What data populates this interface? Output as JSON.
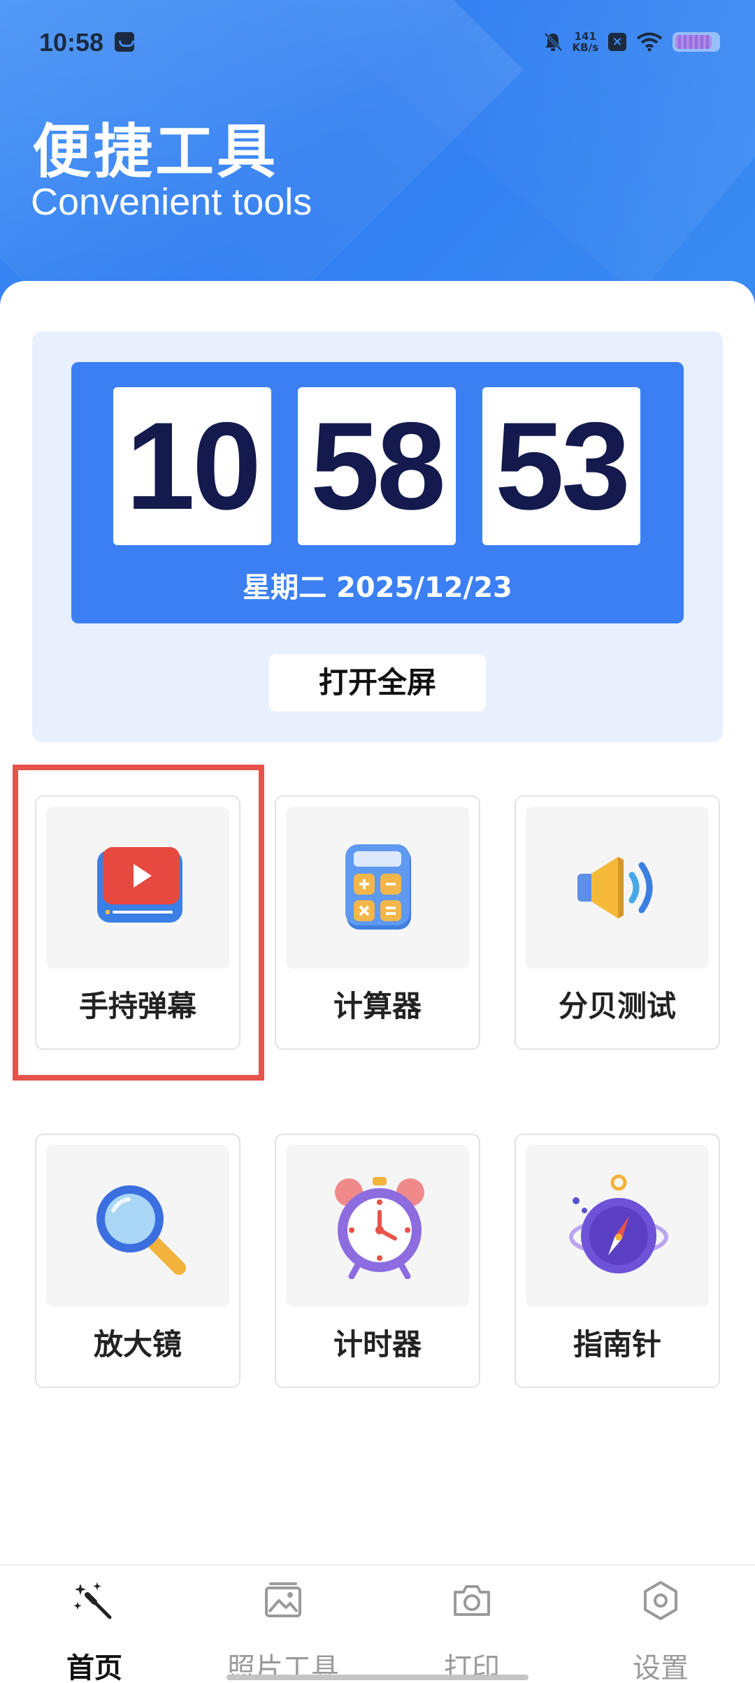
{
  "status_bar": {
    "time": "10:58",
    "net_speed_value": "141",
    "net_speed_unit": "KB/s",
    "icons": [
      "calendar-icon",
      "mute-bell-icon",
      "net-speed-icon",
      "x-app-icon",
      "wifi-icon",
      "battery-icon"
    ]
  },
  "header": {
    "title": "便捷工具",
    "subtitle": "Convenient tools"
  },
  "clock": {
    "hours": "10",
    "minutes": "58",
    "seconds": "53",
    "date": "星期二 2025/12/23",
    "fullscreen_label": "打开全屏"
  },
  "tools": [
    {
      "label": "手持弹幕",
      "icon": "video-banner-icon"
    },
    {
      "label": "计算器",
      "icon": "calculator-icon"
    },
    {
      "label": "分贝测试",
      "icon": "speaker-icon"
    },
    {
      "label": "放大镜",
      "icon": "magnifier-icon"
    },
    {
      "label": "计时器",
      "icon": "alarm-clock-icon"
    },
    {
      "label": "指南针",
      "icon": "compass-icon"
    }
  ],
  "nav": [
    {
      "label": "首页",
      "icon": "magic-wand-icon",
      "active": true
    },
    {
      "label": "照片工具",
      "icon": "photo-icon",
      "active": false
    },
    {
      "label": "打印",
      "icon": "camera-icon",
      "active": false
    },
    {
      "label": "设置",
      "icon": "settings-hex-icon",
      "active": false
    }
  ],
  "colors": {
    "header_blue": "#3f8ef5",
    "clock_face": "#3b7ff3",
    "clock_panel": "#e9f0fd",
    "digit_color": "#141a4d",
    "highlight": "#e5534b"
  }
}
